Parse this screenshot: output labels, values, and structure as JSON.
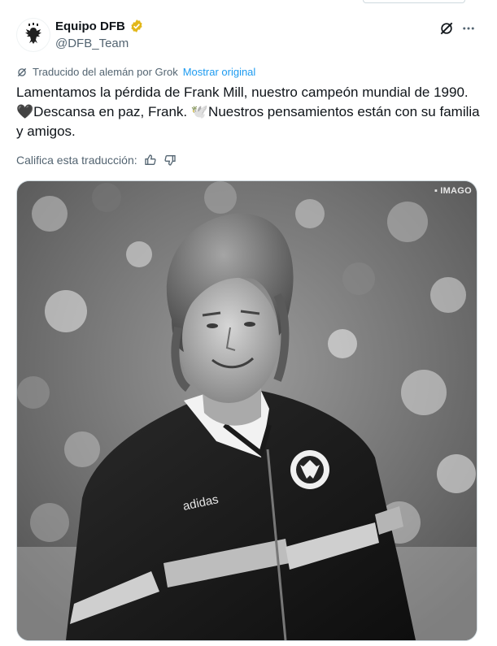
{
  "header": {
    "display_name": "Equipo DFB",
    "handle": "@DFB_Team",
    "verified_icon": "gold-verified-badge-icon",
    "grok_icon": "grok-slash-icon",
    "more_icon": "more-dots-icon"
  },
  "translation": {
    "note": "Traducido del alemán por Grok",
    "show_original": "Mostrar original"
  },
  "tweet": {
    "text": "Lamentamos la pérdida de Frank Mill, nuestro campeón mundial de 1990. 🖤Descansa en paz, Frank. 🕊️Nuestros pensamientos están con su familia y amigos."
  },
  "rating": {
    "label": "Califica esta traducción:",
    "up_icon": "thumbs-up-icon",
    "down_icon": "thumbs-down-icon"
  },
  "media": {
    "watermark": "IMAGO"
  },
  "colors": {
    "link": "#1d9bf0",
    "secondary_text": "#536471",
    "verified_gold": "#e2b719"
  }
}
